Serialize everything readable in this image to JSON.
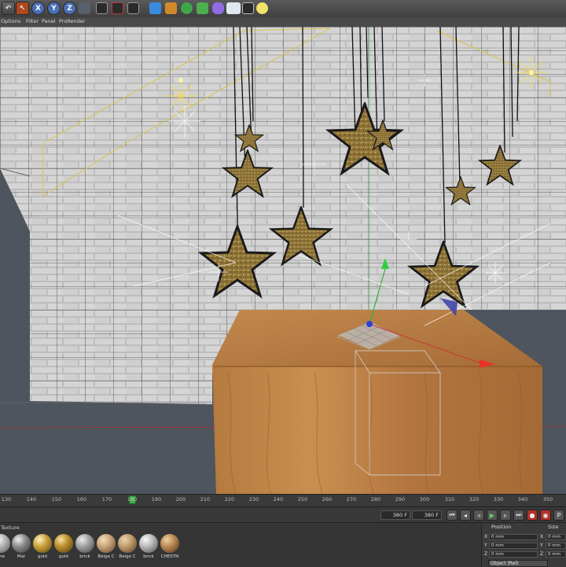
{
  "toolbar": {
    "x_label": "X",
    "y_label": "Y",
    "z_label": "Z"
  },
  "menubar": {
    "items": [
      "Options",
      "Filter",
      "Panel",
      "ProRender"
    ]
  },
  "timeline": {
    "ticks": [
      "130",
      "140",
      "150",
      "160",
      "170",
      "180",
      "190",
      "200",
      "210",
      "220",
      "230",
      "240",
      "250",
      "260",
      "270",
      "280",
      "290",
      "300",
      "310",
      "320",
      "330",
      "340",
      "350"
    ],
    "current_frame": "180"
  },
  "transport": {
    "end_frame": "380 F",
    "end_frame_2": "380 F"
  },
  "materials": {
    "panel_label": "Texture",
    "items": [
      {
        "name": "ane",
        "color": "#b8b8b8"
      },
      {
        "name": "Mat",
        "color": "#8c8c8c"
      },
      {
        "name": "gold",
        "color": "#c9a13a"
      },
      {
        "name": "gold",
        "color": "#b98f2c"
      },
      {
        "name": "brick",
        "color": "#a0a0a0"
      },
      {
        "name": "Beige C",
        "color": "#c7a57a"
      },
      {
        "name": "Beige C",
        "color": "#bf9c6c"
      },
      {
        "name": "brick",
        "color": "#b9b9b9"
      },
      {
        "name": "CHESTN",
        "color": "#b98a55"
      }
    ]
  },
  "coordinates": {
    "position_header": "Position",
    "size_header": "Size",
    "rows": [
      {
        "axis": "X",
        "pos": "0 mm",
        "size_axis": "X",
        "size": "0 mm"
      },
      {
        "axis": "Y",
        "pos": "0 mm",
        "size_axis": "Y",
        "size": "0 mm"
      },
      {
        "axis": "Z",
        "pos": "0 mm",
        "size_axis": "Z",
        "size": "0 mm"
      }
    ],
    "mode": "Object (Rel)"
  }
}
